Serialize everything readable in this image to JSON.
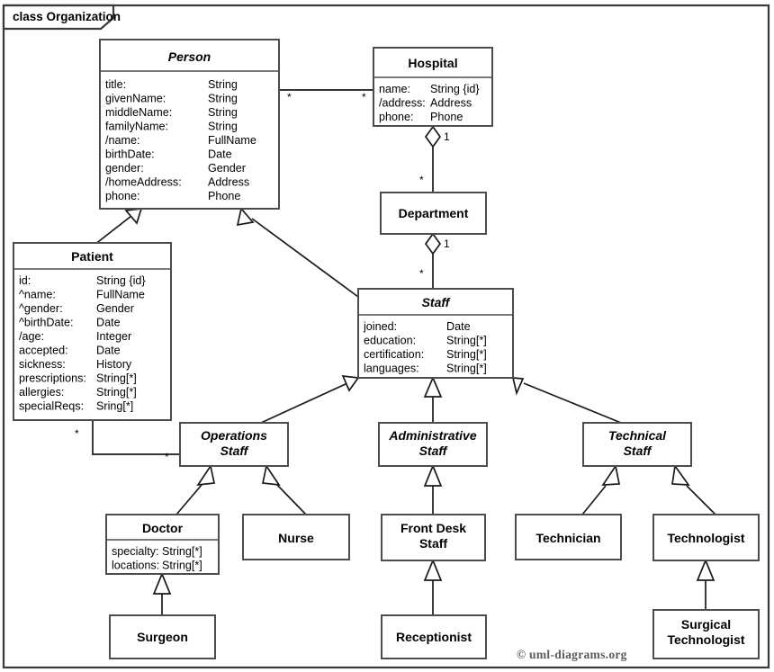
{
  "frame": {
    "label": "class Organization"
  },
  "credit": "© uml-diagrams.org",
  "classes": {
    "person": {
      "name": "Person",
      "abstract": true,
      "attributes": [
        {
          "name": "title:",
          "type": "String"
        },
        {
          "name": "givenName:",
          "type": "String"
        },
        {
          "name": "middleName:",
          "type": "String"
        },
        {
          "name": "familyName:",
          "type": "String"
        },
        {
          "name": "/name:",
          "type": "FullName"
        },
        {
          "name": "birthDate:",
          "type": "Date"
        },
        {
          "name": "gender:",
          "type": "Gender"
        },
        {
          "name": "/homeAddress:",
          "type": "Address"
        },
        {
          "name": "phone:",
          "type": "Phone"
        }
      ]
    },
    "hospital": {
      "name": "Hospital",
      "abstract": false,
      "attributes": [
        {
          "name": "name:",
          "type": "String {id}"
        },
        {
          "name": "/address:",
          "type": "Address"
        },
        {
          "name": "phone:",
          "type": "Phone"
        }
      ]
    },
    "patient": {
      "name": "Patient",
      "abstract": false,
      "attributes": [
        {
          "name": "id:",
          "type": "String {id}"
        },
        {
          "name": "^name:",
          "type": "FullName"
        },
        {
          "name": "^gender:",
          "type": "Gender"
        },
        {
          "name": "^birthDate:",
          "type": "Date"
        },
        {
          "name": "/age:",
          "type": "Integer"
        },
        {
          "name": "accepted:",
          "type": "Date"
        },
        {
          "name": "sickness:",
          "type": "History"
        },
        {
          "name": "prescriptions:",
          "type": "String[*]"
        },
        {
          "name": "allergies:",
          "type": "String[*]"
        },
        {
          "name": "specialReqs:",
          "type": "Sring[*]"
        }
      ]
    },
    "department": {
      "name": "Department",
      "abstract": false,
      "attributes": []
    },
    "staff": {
      "name": "Staff",
      "abstract": true,
      "attributes": [
        {
          "name": "joined:",
          "type": "Date"
        },
        {
          "name": "education:",
          "type": "String[*]"
        },
        {
          "name": "certification:",
          "type": "String[*]"
        },
        {
          "name": "languages:",
          "type": "String[*]"
        }
      ]
    },
    "operations_staff": {
      "name": "Operations Staff",
      "name_line1": "Operations",
      "name_line2": "Staff",
      "abstract": true,
      "attributes": []
    },
    "administrative_staff": {
      "name": "Administrative Staff",
      "name_line1": "Administrative",
      "name_line2": "Staff",
      "abstract": true,
      "attributes": []
    },
    "technical_staff": {
      "name": "Technical Staff",
      "name_line1": "Technical",
      "name_line2": "Staff",
      "abstract": true,
      "attributes": []
    },
    "doctor": {
      "name": "Doctor",
      "abstract": false,
      "attributes": [
        {
          "name": "specialty:",
          "type": "String[*]"
        },
        {
          "name": "locations:",
          "type": "String[*]"
        }
      ]
    },
    "nurse": {
      "name": "Nurse",
      "abstract": false,
      "attributes": []
    },
    "front_desk_staff": {
      "name": "Front Desk Staff",
      "name_line1": "Front Desk",
      "name_line2": "Staff",
      "abstract": false,
      "attributes": []
    },
    "technician": {
      "name": "Technician",
      "abstract": false,
      "attributes": []
    },
    "technologist": {
      "name": "Technologist",
      "abstract": false,
      "attributes": []
    },
    "surgeon": {
      "name": "Surgeon",
      "abstract": false,
      "attributes": []
    },
    "receptionist": {
      "name": "Receptionist",
      "abstract": false,
      "attributes": []
    },
    "surgical_technologist": {
      "name": "Surgical Technologist",
      "name_line1": "Surgical",
      "name_line2": "Technologist",
      "abstract": false,
      "attributes": []
    }
  },
  "multiplicities": {
    "person_hospital_person_end": "*",
    "person_hospital_hospital_end": "*",
    "hospital_department_hospital_end": "1",
    "hospital_department_department_end": "*",
    "department_staff_department_end": "1",
    "department_staff_staff_end": "*",
    "patient_operations_patient_end": "*",
    "patient_operations_staff_end": "*"
  },
  "relationships": [
    {
      "type": "association",
      "from": "Person",
      "to": "Hospital"
    },
    {
      "type": "aggregation",
      "from": "Hospital",
      "to": "Department"
    },
    {
      "type": "aggregation",
      "from": "Department",
      "to": "Staff"
    },
    {
      "type": "association",
      "from": "Patient",
      "to": "Operations Staff"
    },
    {
      "type": "generalization",
      "from": "Patient",
      "to": "Person"
    },
    {
      "type": "generalization",
      "from": "Staff",
      "to": "Person"
    },
    {
      "type": "generalization",
      "from": "Operations Staff",
      "to": "Staff"
    },
    {
      "type": "generalization",
      "from": "Administrative Staff",
      "to": "Staff"
    },
    {
      "type": "generalization",
      "from": "Technical Staff",
      "to": "Staff"
    },
    {
      "type": "generalization",
      "from": "Doctor",
      "to": "Operations Staff"
    },
    {
      "type": "generalization",
      "from": "Nurse",
      "to": "Operations Staff"
    },
    {
      "type": "generalization",
      "from": "Front Desk Staff",
      "to": "Administrative Staff"
    },
    {
      "type": "generalization",
      "from": "Technician",
      "to": "Technical Staff"
    },
    {
      "type": "generalization",
      "from": "Technologist",
      "to": "Technical Staff"
    },
    {
      "type": "generalization",
      "from": "Surgeon",
      "to": "Doctor"
    },
    {
      "type": "generalization",
      "from": "Receptionist",
      "to": "Front Desk Staff"
    },
    {
      "type": "generalization",
      "from": "Surgical Technologist",
      "to": "Technologist"
    }
  ],
  "colors": {
    "background": "#ffffff",
    "box_stroke": "#4d4d4d",
    "line": "#1a1a1a",
    "frame_stroke": "#3a3a3a",
    "credit_text": "#5a5a5a"
  }
}
